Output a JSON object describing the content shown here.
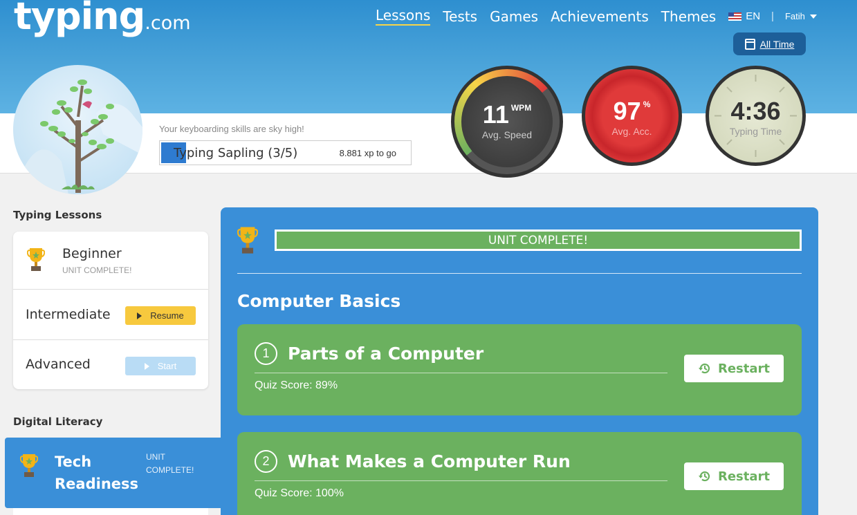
{
  "brand": {
    "logo_main": "typing",
    "logo_suffix": ".com"
  },
  "nav": {
    "items": [
      "Lessons",
      "Tests",
      "Games",
      "Achievements",
      "Themes"
    ],
    "active": "Lessons",
    "language": "EN",
    "user": "Fatih"
  },
  "filter": {
    "label": "All Time"
  },
  "profile": {
    "message": "Your keyboarding skills are sky high!",
    "rank": "Typing Sapling (3/5)",
    "xp_to_go": "8.881 xp to go",
    "rank_progress_fraction": 0.1
  },
  "stats": {
    "speed": {
      "value": "11",
      "unit": "WPM",
      "label": "Avg. Speed"
    },
    "accuracy": {
      "value": "97",
      "unit": "%",
      "label": "Avg. Acc."
    },
    "time": {
      "value": "4:36",
      "label": "Typing Time"
    }
  },
  "sidebar": {
    "typing_heading": "Typing Lessons",
    "typing_items": [
      {
        "title": "Beginner",
        "status": "UNIT COMPLETE!"
      },
      {
        "title": "Intermediate",
        "button": "Resume"
      },
      {
        "title": "Advanced",
        "button": "Start"
      }
    ],
    "digital_heading": "Digital Literacy",
    "digital_items": [
      {
        "title_line1": "Tech",
        "title_line2": "Readiness",
        "status_line1": "UNIT",
        "status_line2": "COMPLETE!"
      }
    ]
  },
  "main": {
    "unit_status": "UNIT COMPLETE!",
    "section_title": "Computer Basics",
    "lessons": [
      {
        "number": "1",
        "title": "Parts of a Computer",
        "score": "Quiz Score: 89%",
        "action": "Restart"
      },
      {
        "number": "2",
        "title": "What Makes a Computer Run",
        "score": "Quiz Score: 100%",
        "action": "Restart"
      }
    ]
  },
  "colors": {
    "header_blue": "#2e8fd0",
    "panel_blue": "#3a8fd8",
    "lesson_green": "#6bb15f",
    "resume_yellow": "#f7c93e",
    "accuracy_red": "#e03a3a"
  }
}
